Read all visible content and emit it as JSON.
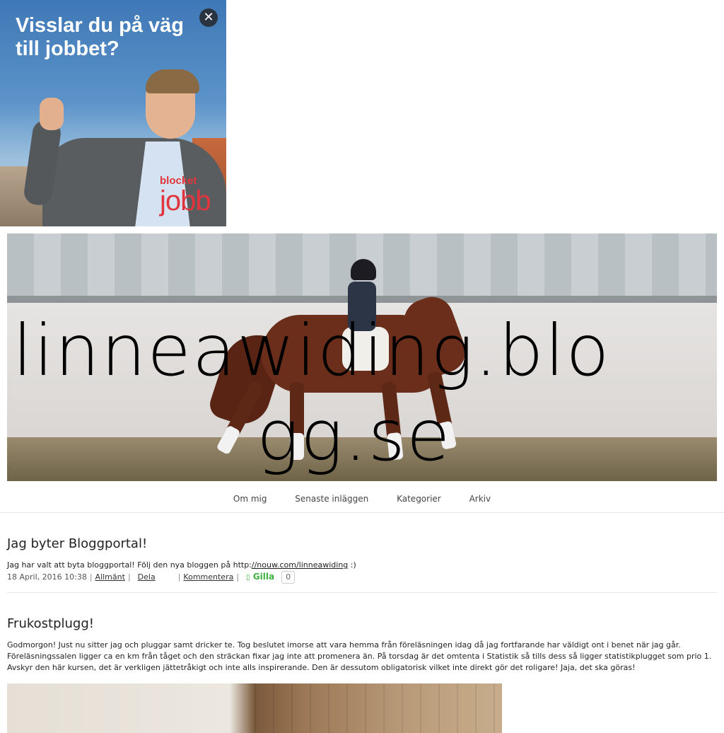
{
  "ad": {
    "headline": "Visslar du på väg till jobbet?",
    "close_icon": "close-icon",
    "brand_top": "blocket",
    "brand_bottom": "jobb",
    "brand_color": "#e0353d"
  },
  "header": {
    "site_title_line1": "linneawiding.blo",
    "site_title_line2": "gg.se"
  },
  "nav": {
    "items": [
      "Om mig",
      "Senaste inläggen",
      "Kategorier",
      "Arkiv"
    ]
  },
  "posts": [
    {
      "title": "Jag byter Bloggportal!",
      "body_prefix": "Jag har valt att byta bloggportal! Följ den nya bloggen på http:",
      "body_link": "//nouw.com/linneawiding",
      "body_suffix": " :)",
      "date": "18 April, 2016 10:38",
      "category": "Allmänt",
      "share": "Dela",
      "comment": "Kommentera",
      "like": "Gilla",
      "like_count": "0"
    },
    {
      "title": "Frukostplugg!",
      "body": "Godmorgon! Just nu sitter jag och pluggar samt dricker te. Tog beslutet imorse att vara hemma från föreläsningen idag då jag fortfarande har väldigt ont i benet när jag går. Föreläsningssalen ligger ca en km från tåget och den sträckan fixar jag inte att promenera än. På torsdag är det omtenta i Statistik så tills dess så ligger statistikplugget som prio 1. Avskyr den här kursen, det är verkligen jättetråkigt och inte alls inspirerande. Den är dessutom obligatorisk vilket inte direkt gör det roligare! Jaja, det ska göras!"
    }
  ],
  "colors": {
    "like_green": "#3db23d"
  }
}
